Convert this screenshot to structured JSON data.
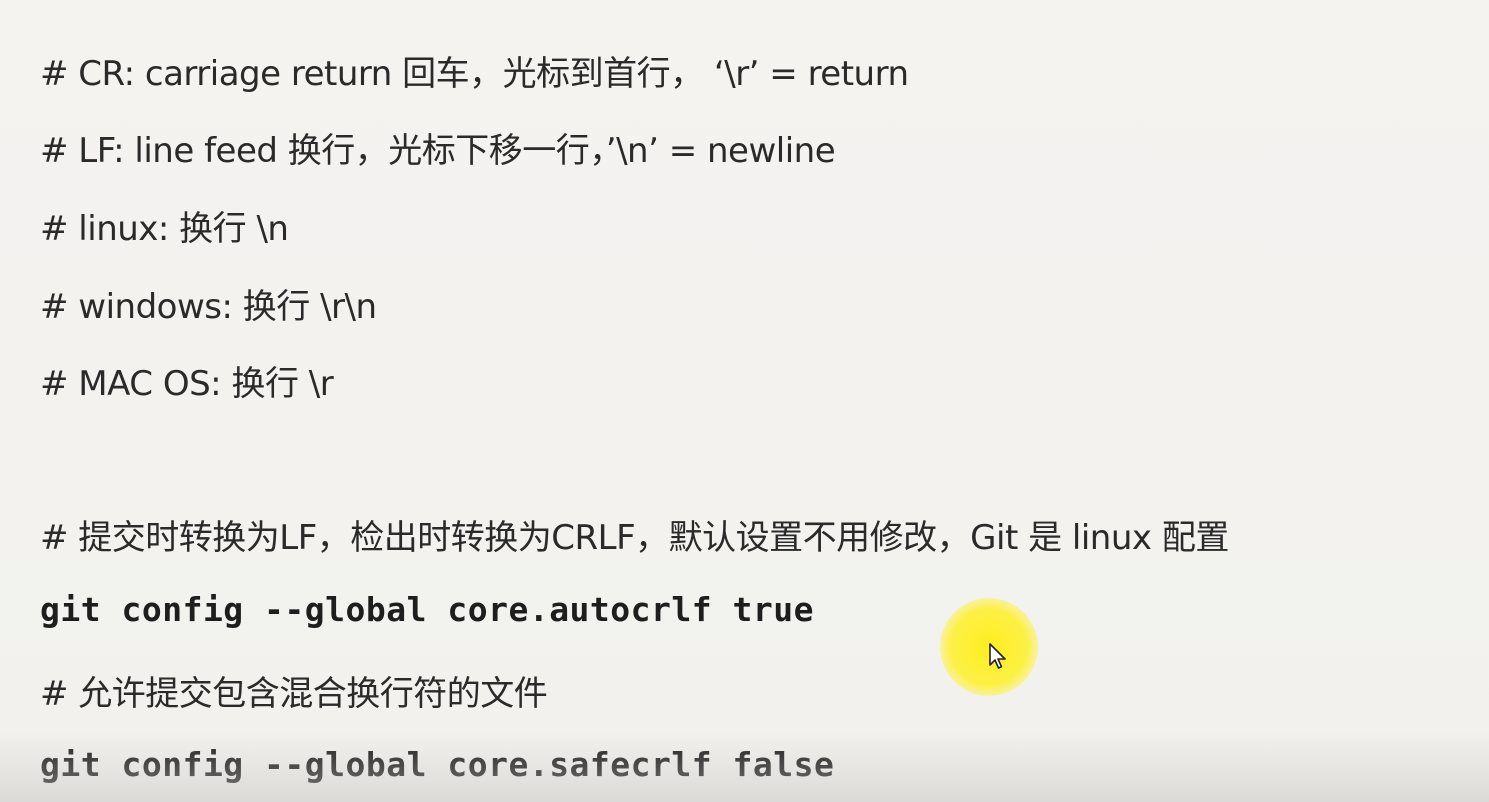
{
  "lines": [
    {
      "text": "# CR: carriage return 回车，光标到首行， ‘\\r’ = return"
    },
    {
      "text": "# LF: line feed 换行，光标下移一行，’\\n’ = newline"
    },
    {
      "text": "# linux: 换行 \\n"
    },
    {
      "text": "# windows: 换行 \\r\\n"
    },
    {
      "text": "# MAC OS: 换行 \\r"
    },
    {
      "text": "# 提交时转换为LF，检出时转换为CRLF，默认设置不用修改，Git 是 linux 配置"
    },
    {
      "text": "git config --global core.autocrlf true"
    },
    {
      "text": "# 允许提交包含混合换行符的文件"
    },
    {
      "text": "git config --global core.safecrlf false"
    }
  ],
  "overlay": {
    "cursor_icon": "mouse-pointer-icon",
    "highlight_color": "#ffee14"
  }
}
